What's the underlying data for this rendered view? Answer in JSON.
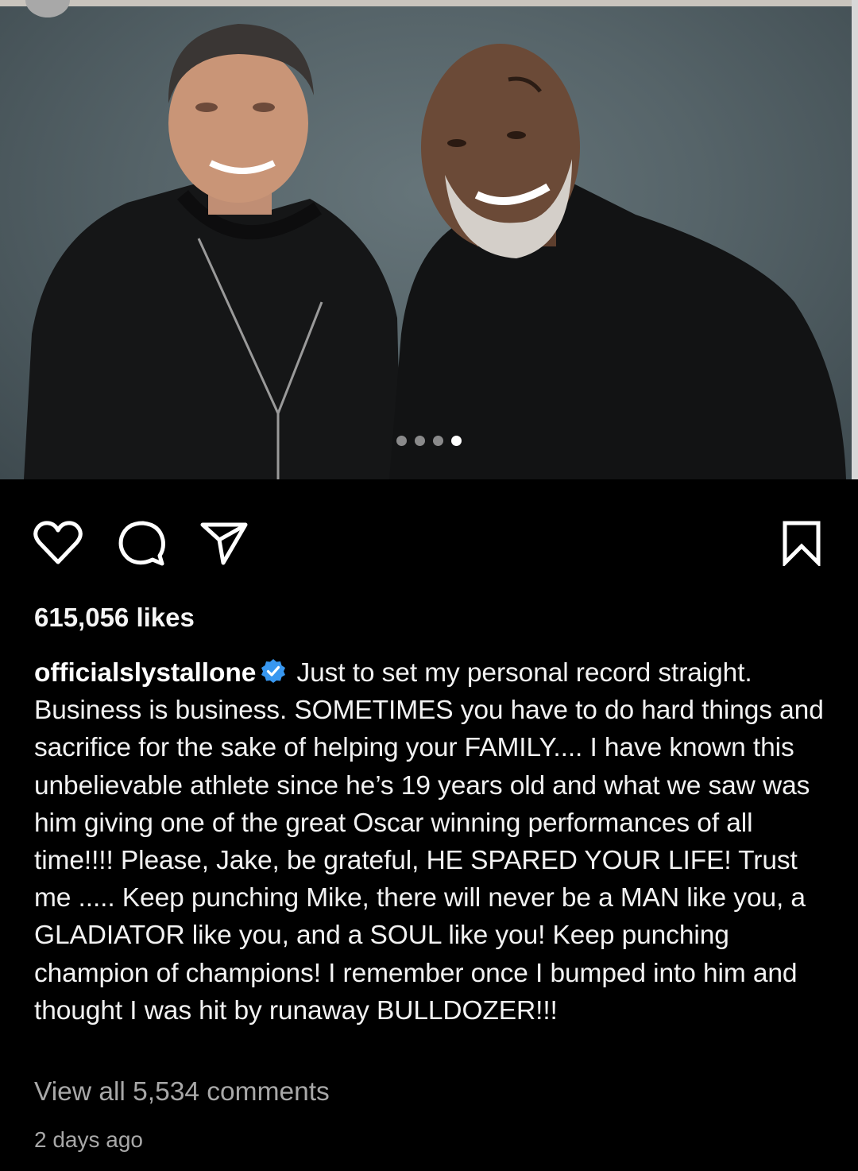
{
  "post": {
    "carousel": {
      "total": 4,
      "active_index": 3
    },
    "actions": {
      "like_icon": "heart-outline-icon",
      "comment_icon": "comment-bubble-icon",
      "share_icon": "paper-plane-icon",
      "save_icon": "bookmark-outline-icon"
    },
    "likes_text": "615,056 likes",
    "username": "officialslystallone",
    "verified_color": "#3897f0",
    "caption_text": "Just to set my personal record straight. Business is business. SOMETIMES you have to do hard things and sacrifice for the sake of helping your FAMILY.... I have known this unbelievable athlete since he’s 19 years old and what we saw was him giving one of the great Oscar winning performances of all time!!!! Please, Jake, be grateful, HE SPARED YOUR LIFE! Trust me ..... Keep punching Mike, there will never be a MAN like you, a GLADIATOR like you, and a SOUL like you! Keep punching champion of champions! I remember once I bumped into him and thought I was hit by runaway BULLDOZER!!!",
    "view_comments_text": "View all 5,534 comments",
    "timestamp_text": "2 days ago"
  }
}
